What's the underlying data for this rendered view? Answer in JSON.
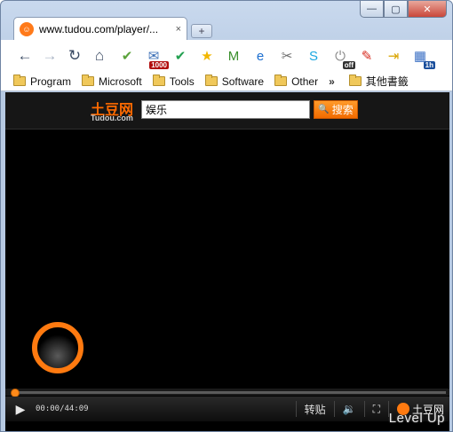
{
  "window": {
    "minimize": "—",
    "maximize": "▢",
    "close": "✕"
  },
  "tab": {
    "title": "www.tudou.com/player/...",
    "close": "×",
    "favicon": "tudou-favicon-icon"
  },
  "new_tab": "+",
  "toolbar": {
    "back": "←",
    "forward": "→",
    "reload": "↻",
    "home": "⌂",
    "extensions": [
      {
        "icon": "check-icon",
        "glyph": "✔",
        "color": "#5aa23a",
        "badge": ""
      },
      {
        "icon": "gmail-checker-icon",
        "glyph": "✉",
        "color": "#3b6fb6",
        "badge": "1000"
      },
      {
        "icon": "approve-icon",
        "glyph": "✔",
        "color": "#22a050",
        "badge": ""
      },
      {
        "icon": "star-icon",
        "glyph": "★",
        "color": "#f2b600",
        "badge": ""
      },
      {
        "icon": "mcafee-icon",
        "glyph": "M",
        "color": "#3a8f2c",
        "badge": ""
      },
      {
        "icon": "ie-tab-icon",
        "glyph": "e",
        "color": "#1c6fd0",
        "badge": ""
      },
      {
        "icon": "tools-icon",
        "glyph": "✂",
        "color": "#6b6b6b",
        "badge": ""
      },
      {
        "icon": "skype-icon",
        "glyph": "S",
        "color": "#1aa7e0",
        "badge": ""
      },
      {
        "icon": "power-off-icon",
        "glyph": "⏻",
        "color": "#8a8a8a",
        "badge": "off"
      },
      {
        "icon": "pepper-icon",
        "glyph": "✎",
        "color": "#d62a1e",
        "badge": ""
      },
      {
        "icon": "send-to-phone-icon",
        "glyph": "⇥",
        "color": "#d9a400",
        "badge": ""
      },
      {
        "icon": "calendar-icon",
        "glyph": "▦",
        "color": "#3a6fc4",
        "badge": "1h"
      }
    ]
  },
  "bookmarks": {
    "items": [
      "Program",
      "Microsoft",
      "Tools",
      "Software",
      "Other"
    ],
    "overflow": "»",
    "other_bookmarks": "其他書籤"
  },
  "site": {
    "logo": "土豆网",
    "logo_sub": "Tudou.com",
    "search_value": "娱乐",
    "search_button": "搜索"
  },
  "player": {
    "progress": 0,
    "time": "00:00/44:09",
    "repost": "转贴",
    "volume_icon": "volume-icon",
    "fullscreen_icon": "fullscreen-icon",
    "brand": "土豆网"
  },
  "watermark": "Level Up",
  "colors": {
    "accent": "#ff7a10",
    "player_bg": "#000000"
  }
}
